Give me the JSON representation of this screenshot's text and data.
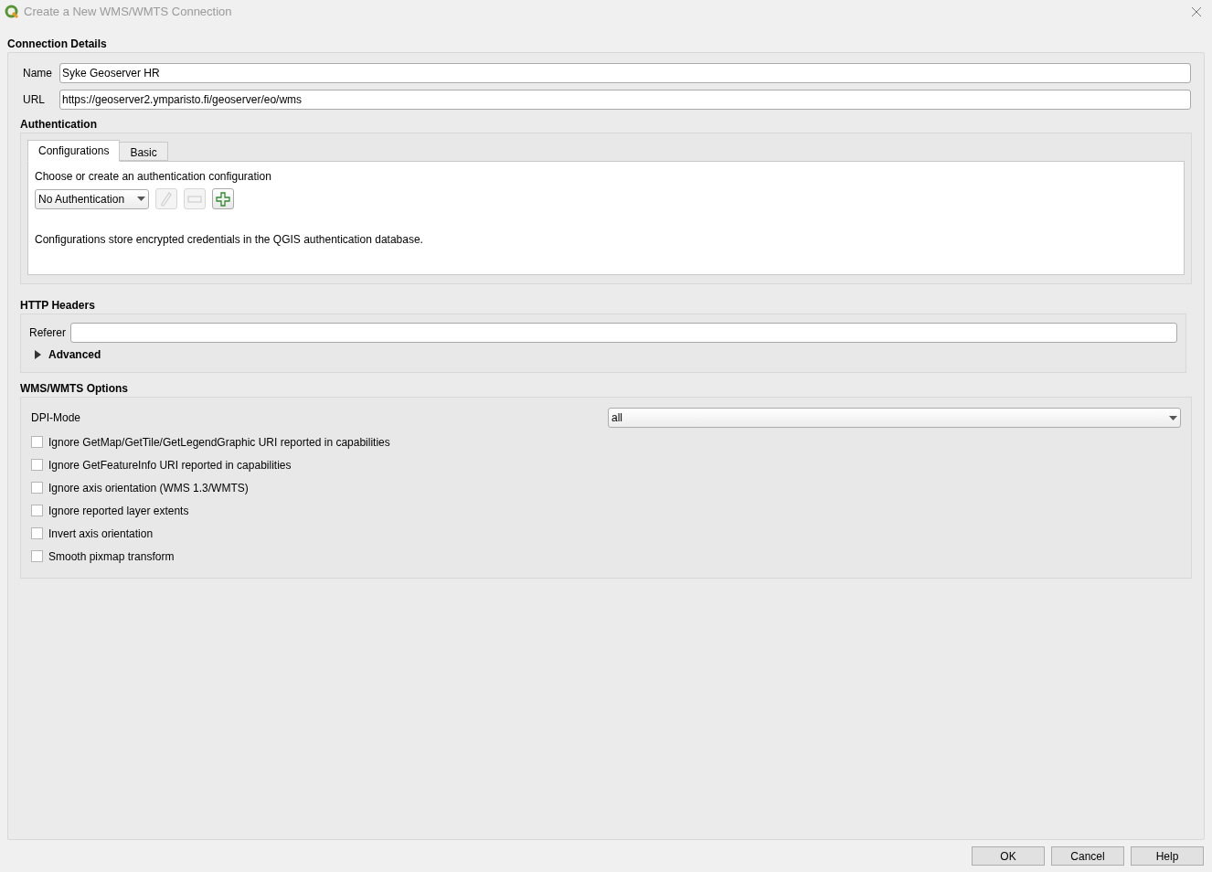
{
  "window": {
    "title": "Create a New WMS/WMTS Connection"
  },
  "connection_details": {
    "heading": "Connection Details",
    "fields": [
      {
        "label": "Name",
        "value": "Syke Geoserver HR"
      },
      {
        "label": "URL",
        "value": "https://geoserver2.ymparisto.fi/geoserver/eo/wms"
      }
    ]
  },
  "authentication": {
    "heading": "Authentication",
    "tabs": [
      {
        "label": "Configurations",
        "selected": true
      },
      {
        "label": "Basic",
        "selected": false
      }
    ],
    "prompt": "Choose or create an authentication configuration",
    "config_select": "No Authentication",
    "tools": [
      {
        "kind": "edit",
        "disabled": true
      },
      {
        "kind": "remove",
        "disabled": true
      },
      {
        "kind": "add",
        "disabled": false
      }
    ],
    "note": "Configurations store encrypted credentials in the QGIS authentication database."
  },
  "http_headers": {
    "heading": "HTTP Headers",
    "referer_label": "Referer",
    "advanced": {
      "label": "Advanced",
      "expanded": false
    }
  },
  "wms_options": {
    "heading": "WMS/WMTS Options",
    "dpi_label": "DPI-Mode",
    "dpi_value": "all",
    "checkboxes": [
      {
        "label": "Ignore GetMap/GetTile/GetLegendGraphic URI reported in capabilities",
        "checked": false
      },
      {
        "label": "Ignore GetFeatureInfo URI reported in capabilities",
        "checked": false
      },
      {
        "label": "Ignore axis orientation (WMS 1.3/WMTS)",
        "checked": false
      },
      {
        "label": "Ignore reported layer extents",
        "checked": false
      },
      {
        "label": "Invert axis orientation",
        "checked": false
      },
      {
        "label": "Smooth pixmap transform",
        "checked": false
      }
    ]
  },
  "buttons": [
    "OK",
    "Cancel",
    "Help"
  ]
}
